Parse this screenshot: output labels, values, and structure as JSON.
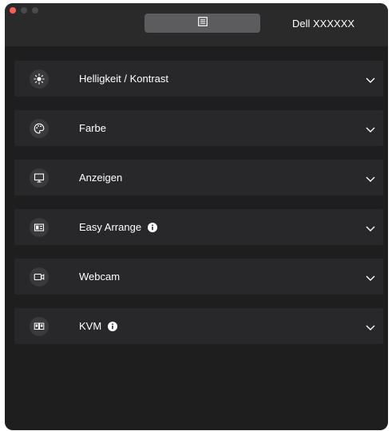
{
  "titlebar": {
    "monitor_name": "Dell XXXXXX",
    "doc_icon": "document-list-icon"
  },
  "colors": {
    "close_button": "#ff5f57",
    "window_bg": "#1e1e1f",
    "section_bg": "#28282a",
    "text": "#ffffff"
  },
  "sections": [
    {
      "label": "Helligkeit / Kontrast",
      "icon": "brightness-icon",
      "info": false
    },
    {
      "label": "Farbe",
      "icon": "palette-icon",
      "info": false
    },
    {
      "label": "Anzeigen",
      "icon": "display-icon",
      "info": false
    },
    {
      "label": "Easy Arrange",
      "icon": "easy-arrange-icon",
      "info": true
    },
    {
      "label": "Webcam",
      "icon": "webcam-icon",
      "info": false
    },
    {
      "label": "KVM",
      "icon": "kvm-icon",
      "info": true
    }
  ]
}
